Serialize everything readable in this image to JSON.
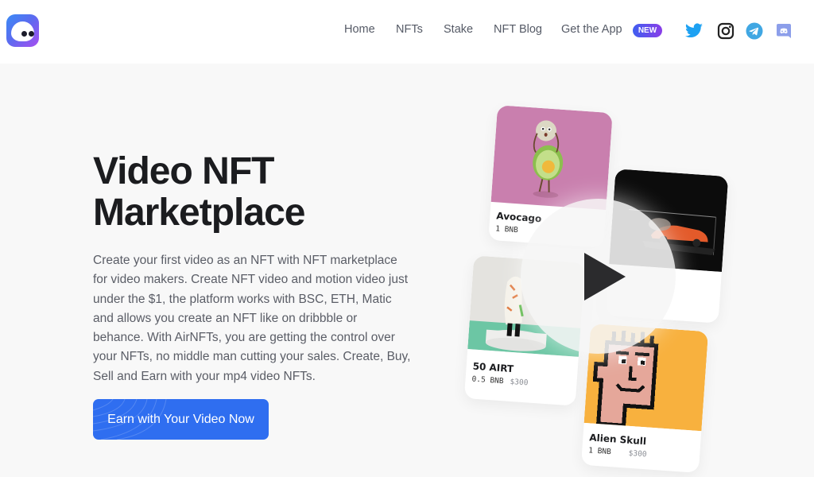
{
  "header": {
    "logo_alt": "AirNFTs",
    "nav": [
      {
        "label": "Home"
      },
      {
        "label": "NFTs"
      },
      {
        "label": "Stake"
      },
      {
        "label": "NFT Blog"
      },
      {
        "label": "Get the App"
      }
    ],
    "new_badge": "NEW",
    "social": [
      {
        "icon": "twitter-icon",
        "color": "#1da1f2"
      },
      {
        "icon": "instagram-icon",
        "color": "#222222"
      },
      {
        "icon": "telegram-icon",
        "color": "#40a7e3"
      },
      {
        "icon": "discord-icon",
        "color": "#8c9eea"
      }
    ]
  },
  "hero": {
    "title_line1": "Video NFT",
    "title_line2": "Marketplace",
    "description": "Create your first video as an NFT with NFT marketplace for video makers. Create NFT video and motion video just under the $1, the platform works with BSC, ETH, Matic and allows you create an NFT like on dribbble or behance. With AirNFTs, you are getting the control over your NFTs, no middle man cutting your sales. Create, Buy, Sell and Earn with your mp4 video NFTs.",
    "cta_label": "Earn with Your Video Now",
    "accent_color": "#2f6ef0"
  },
  "cards": [
    {
      "name": "Avocago",
      "price": "1 BNB",
      "usd": "",
      "bg": "#c97fae"
    },
    {
      "name": "",
      "price": "",
      "usd": "",
      "bg": "#0c0c0c"
    },
    {
      "name": "50 AIRT",
      "price": "0.5 BNB",
      "usd": "$300",
      "bg": "#e6e6e2"
    },
    {
      "name": "Alien Skull",
      "price": "1 BNB",
      "usd": "$300",
      "bg": "#f8b13e"
    }
  ]
}
